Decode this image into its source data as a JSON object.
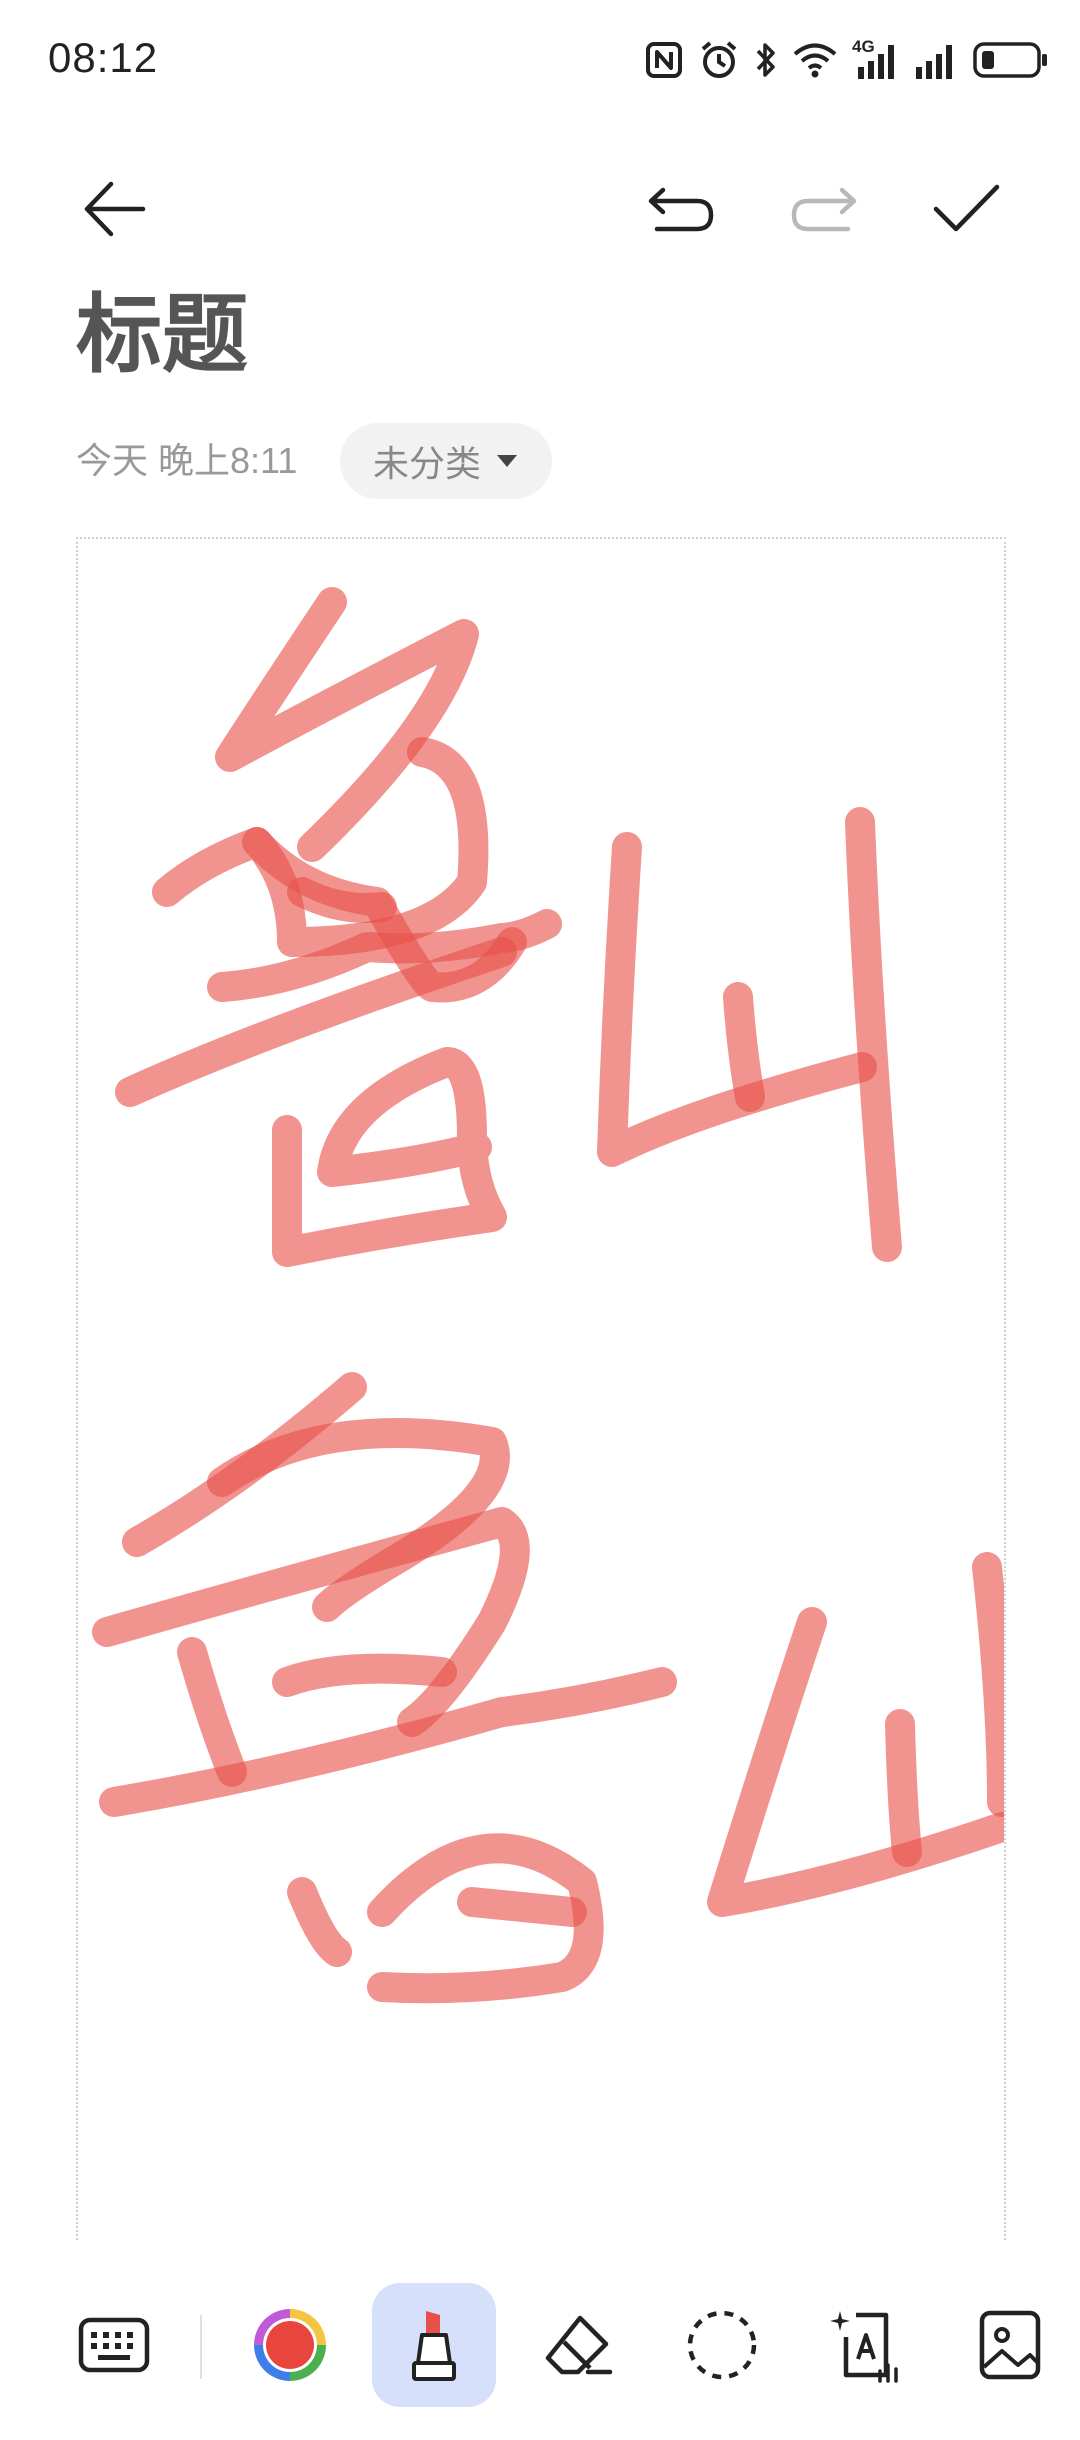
{
  "status_bar": {
    "time": "08:12",
    "network_label": "4G"
  },
  "toolbar": {
    "icons": [
      "back-arrow-icon",
      "undo-icon",
      "redo-icon",
      "check-icon"
    ]
  },
  "note": {
    "title": "标题",
    "date": "今天 晚上8:11",
    "category": "未分类"
  },
  "drawing": {
    "stroke_color": "#e8504a",
    "stroke_opacity": 0.62
  },
  "bottom_toolbar": {
    "tools": [
      "keyboard-icon",
      "color-wheel-icon",
      "marker-pen-icon",
      "eraser-icon",
      "lasso-select-icon",
      "handwriting-to-text-icon",
      "insert-image-icon"
    ],
    "selected_tool": "marker-pen-icon"
  },
  "colors": {
    "accent_selected": "#d6e0fb",
    "chip_background": "#f2f2f2"
  }
}
